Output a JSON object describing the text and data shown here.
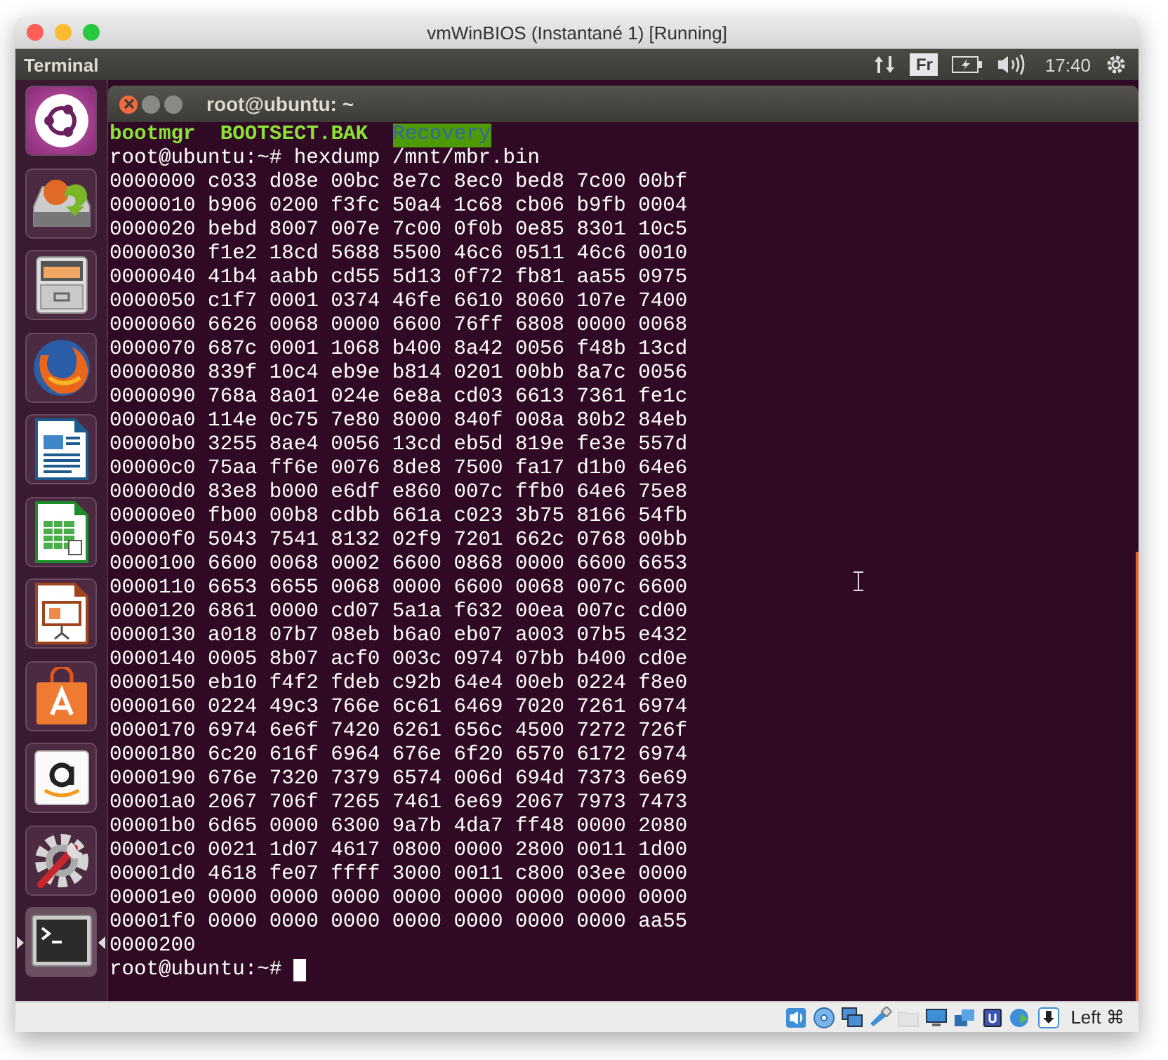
{
  "window": {
    "title": "vmWinBIOS (Instantané 1) [Running]"
  },
  "panel": {
    "app_name": "Terminal",
    "keyboard": "Fr",
    "time": "17:40"
  },
  "launcher": [
    {
      "kind": "ubuntu",
      "focused": false
    },
    {
      "kind": "drive",
      "focused": false
    },
    {
      "kind": "cabinet",
      "focused": false
    },
    {
      "kind": "browser",
      "focused": false
    },
    {
      "kind": "writer",
      "focused": false
    },
    {
      "kind": "calc",
      "focused": false
    },
    {
      "kind": "impress",
      "focused": false
    },
    {
      "kind": "bag",
      "focused": false
    },
    {
      "kind": "letter",
      "focused": false
    },
    {
      "kind": "tools",
      "focused": false
    },
    {
      "kind": "terminal",
      "focused": true
    }
  ],
  "terminal": {
    "title": "root@ubuntu: ~",
    "ls_entries": [
      {
        "name": "bootmgr",
        "kind": "exec"
      },
      {
        "name": "BOOTSECT.BAK",
        "kind": "exec"
      },
      {
        "name": "Recovery",
        "kind": "dir_writable"
      }
    ],
    "command": {
      "prompt": "root@ubuntu:~#",
      "text": "hexdump /mnt/mbr.bin"
    },
    "output": [
      "0000000 c033 d08e 00bc 8e7c 8ec0 bed8 7c00 00bf",
      "0000010 b906 0200 f3fc 50a4 1c68 cb06 b9fb 0004",
      "0000020 bebd 8007 007e 7c00 0f0b 0e85 8301 10c5",
      "0000030 f1e2 18cd 5688 5500 46c6 0511 46c6 0010",
      "0000040 41b4 aabb cd55 5d13 0f72 fb81 aa55 0975",
      "0000050 c1f7 0001 0374 46fe 6610 8060 107e 7400",
      "0000060 6626 0068 0000 6600 76ff 6808 0000 0068",
      "0000070 687c 0001 1068 b400 8a42 0056 f48b 13cd",
      "0000080 839f 10c4 eb9e b814 0201 00bb 8a7c 0056",
      "0000090 768a 8a01 024e 6e8a cd03 6613 7361 fe1c",
      "00000a0 114e 0c75 7e80 8000 840f 008a 80b2 84eb",
      "00000b0 3255 8ae4 0056 13cd eb5d 819e fe3e 557d",
      "00000c0 75aa ff6e 0076 8de8 7500 fa17 d1b0 64e6",
      "00000d0 83e8 b000 e6df e860 007c ffb0 64e6 75e8",
      "00000e0 fb00 00b8 cdbb 661a c023 3b75 8166 54fb",
      "00000f0 5043 7541 8132 02f9 7201 662c 0768 00bb",
      "0000100 6600 0068 0002 6600 0868 0000 6600 6653",
      "0000110 6653 6655 0068 0000 6600 0068 007c 6600",
      "0000120 6861 0000 cd07 5a1a f632 00ea 007c cd00",
      "0000130 a018 07b7 08eb b6a0 eb07 a003 07b5 e432",
      "0000140 0005 8b07 acf0 003c 0974 07bb b400 cd0e",
      "0000150 eb10 f4f2 fdeb c92b 64e4 00eb 0224 f8e0",
      "0000160 0224 49c3 766e 6c61 6469 7020 7261 6974",
      "0000170 6974 6e6f 7420 6261 656c 4500 7272 726f",
      "0000180 6c20 616f 6964 676e 6f20 6570 6172 6974",
      "0000190 676e 7320 7379 6574 006d 694d 7373 6e69",
      "00001a0 2067 706f 7265 7461 6e69 2067 7973 7473",
      "00001b0 6d65 0000 6300 9a7b 4da7 ff48 0000 2080",
      "00001c0 0021 1d07 4617 0800 0000 2800 0011 1d00",
      "00001d0 4618 fe07 ffff 3000 0011 c800 03ee 0000",
      "00001e0 0000 0000 0000 0000 0000 0000 0000 0000",
      "00001f0 0000 0000 0000 0000 0000 0000 0000 aa55",
      "0000200"
    ],
    "final_prompt": "root@ubuntu:~#"
  },
  "status_icons": [
    {
      "kind": "audio",
      "disabled": false
    },
    {
      "kind": "disc",
      "disabled": false
    },
    {
      "kind": "network",
      "disabled": false
    },
    {
      "kind": "usb",
      "disabled": false
    },
    {
      "kind": "folder",
      "disabled": true
    },
    {
      "kind": "display",
      "disabled": false
    },
    {
      "kind": "displays",
      "disabled": false
    },
    {
      "kind": "cpu",
      "disabled": false
    },
    {
      "kind": "globe",
      "disabled": false
    },
    {
      "kind": "download",
      "disabled": false
    }
  ],
  "host_key": "Left ⌘"
}
